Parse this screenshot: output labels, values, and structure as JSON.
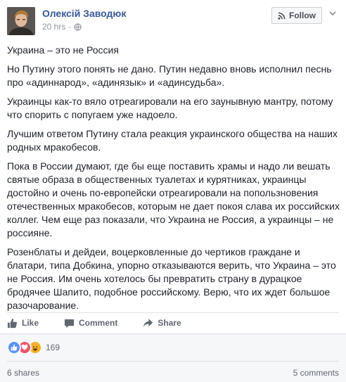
{
  "post": {
    "author": "Олексій Заводюк",
    "time": "20 hrs",
    "dot": "·",
    "follow_label": "Follow",
    "paragraphs": [
      "Украина – это не Россия",
      "Но Путину этого понять не дано. Путин недавно вновь исполнил песнь про «адиннарод», «адинязык» и «адинсудьба».",
      "Украинцы как-то вяло отреагировали на его заунывную мантру, потому что спорить с попугаем уже надоело.",
      "Лучшим ответом Путину стала реакция украинского общества на наших родных мракобесов.",
      "Пока в России думают, где бы еще поставить храмы и надо ли вешать святые образа в общественных туалетах и курятниках, украинцы достойно и очень по-европейски отреагировали на попользновения отечественных мракобесов, которым не дает покоя слава их российских коллег. Чем еще раз показали, что Украина не Россия, а украинцы – не россияне.",
      "Розенблаты и дейдеи, воцерковленные до чертиков граждане и блатари, типа Добкина, упорно отказываются верить, что Украина – это не Россия. Им очень хотелось бы превратить страну в дурацкое бродячее Шапито, подобное российскому. Верю, что их ждет большое разочарование."
    ]
  },
  "actions": {
    "like": "Like",
    "comment": "Comment",
    "share": "Share"
  },
  "footer": {
    "reaction_count": "169",
    "shares": "6 shares",
    "comments": "5 comments"
  },
  "icons": {
    "reactions": [
      "like-reaction",
      "love-reaction",
      "haha-reaction"
    ],
    "privacy": "globe-icon",
    "follow": "rss-icon"
  },
  "colors": {
    "link": "#365899",
    "muted": "#90949c",
    "action": "#616770",
    "like_blue": "#5890ff",
    "love_red": "#f25268",
    "haha_yellow": "#f7b125"
  }
}
